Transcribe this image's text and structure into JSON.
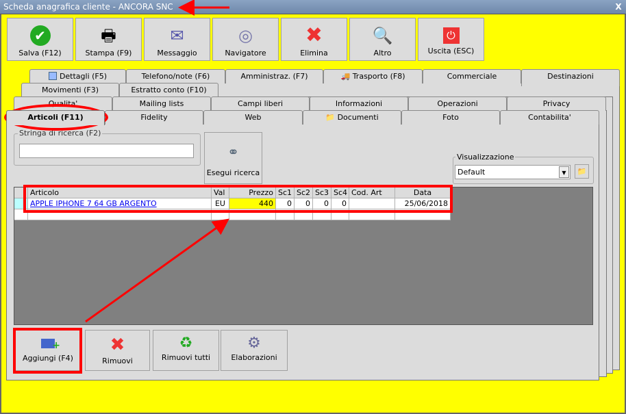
{
  "window": {
    "title": "Scheda anagrafica cliente - ANCORA SNC",
    "close": "X"
  },
  "toolbar": [
    {
      "label": "Salva (F12)",
      "icon": "check-icon"
    },
    {
      "label": "Stampa (F9)",
      "icon": "printer-icon"
    },
    {
      "label": "Messaggio",
      "icon": "envelope-pen-icon"
    },
    {
      "label": "Navigatore",
      "icon": "compass-icon"
    },
    {
      "label": "Elimina",
      "icon": "x-icon"
    },
    {
      "label": "Altro",
      "icon": "book-search-icon"
    },
    {
      "label": "Uscita (ESC)",
      "icon": "power-icon"
    }
  ],
  "tabs": {
    "row1": [
      "Dettagli (F5)",
      "Telefono/note (F6)",
      "Amministraz. (F7)",
      "Trasporto (F8)",
      "Commerciale",
      "Destinazioni"
    ],
    "row2": [
      "Movimenti (F3)",
      "Estratto conto (F10)"
    ],
    "row3": [
      "Qualita'",
      "Mailing lists",
      "Campi liberi",
      "Informazioni",
      "Operazioni",
      "Privacy"
    ],
    "row4": [
      "Articoli (F11)",
      "Fidelity",
      "Web",
      "Documenti",
      "Foto",
      "Contabilita'"
    ]
  },
  "search": {
    "label": "Stringa di ricerca (F2)",
    "value": "",
    "button": "Esegui ricerca"
  },
  "view": {
    "label": "Visualizzazione",
    "selected": "Default"
  },
  "grid": {
    "columns": [
      "Articolo",
      "Val",
      "Prezzo",
      "Sc1",
      "Sc2",
      "Sc3",
      "Sc4",
      "Cod. Art",
      "Data"
    ],
    "rows": [
      [
        "APPLE IPHONE 7 64 GB ARGENTO",
        "EU",
        "440",
        "0",
        "0",
        "0",
        "0",
        "",
        "25/06/2018"
      ]
    ]
  },
  "actions": [
    "Aggiungi (F4)",
    "Rimuovi",
    "Rimuovi tutti",
    "Elaborazioni"
  ],
  "colors": {
    "background": "#ffff00",
    "highlight": "#ffff00",
    "annotation": "#ff0000",
    "link": "#0000ee"
  }
}
